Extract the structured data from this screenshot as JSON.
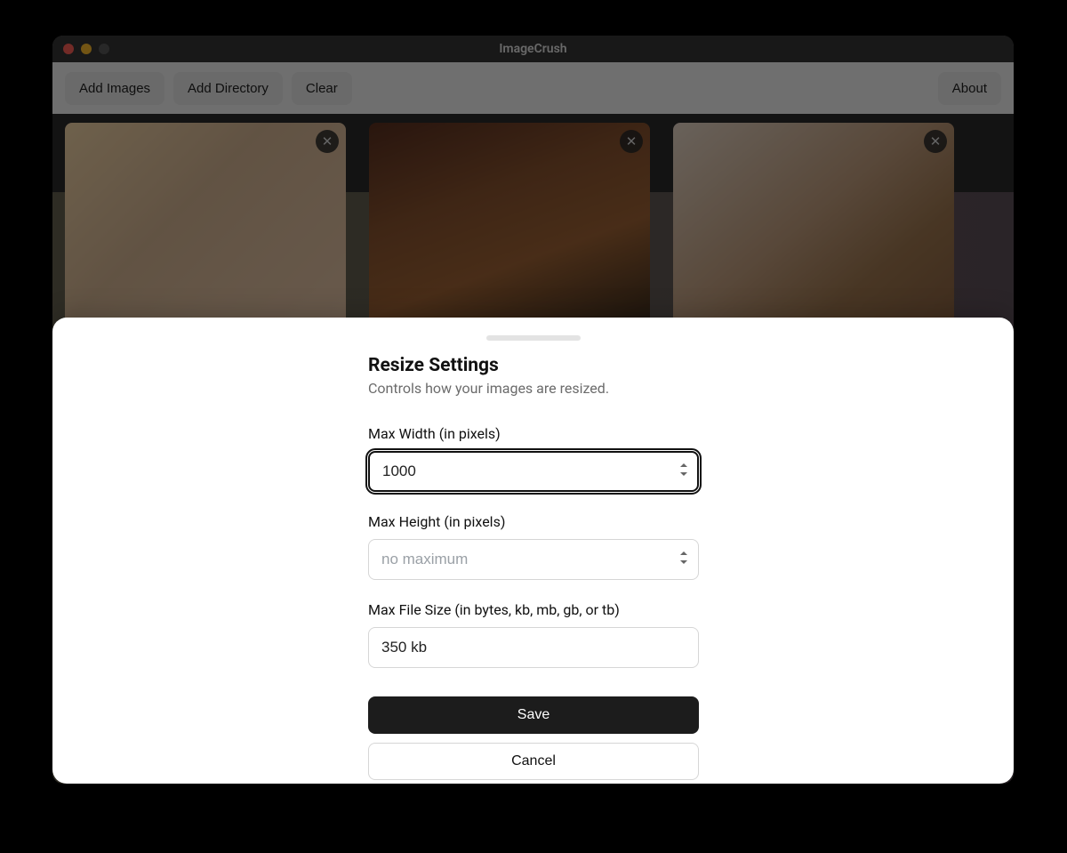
{
  "app": {
    "title": "ImageCrush"
  },
  "toolbar": {
    "add_images": "Add Images",
    "add_directory": "Add Directory",
    "clear": "Clear",
    "about": "About"
  },
  "images": [
    {
      "close_glyph": "✕"
    },
    {
      "close_glyph": "✕"
    },
    {
      "close_glyph": "✕"
    }
  ],
  "modal": {
    "title": "Resize Settings",
    "subtitle": "Controls how your images are resized.",
    "fields": {
      "max_width": {
        "label": "Max Width (in pixels)",
        "value": "1000",
        "placeholder": ""
      },
      "max_height": {
        "label": "Max Height (in pixels)",
        "value": "",
        "placeholder": "no maximum"
      },
      "max_filesize": {
        "label": "Max File Size (in bytes, kb, mb, gb, or tb)",
        "value": "350 kb",
        "placeholder": ""
      }
    },
    "buttons": {
      "save": "Save",
      "cancel": "Cancel"
    }
  }
}
